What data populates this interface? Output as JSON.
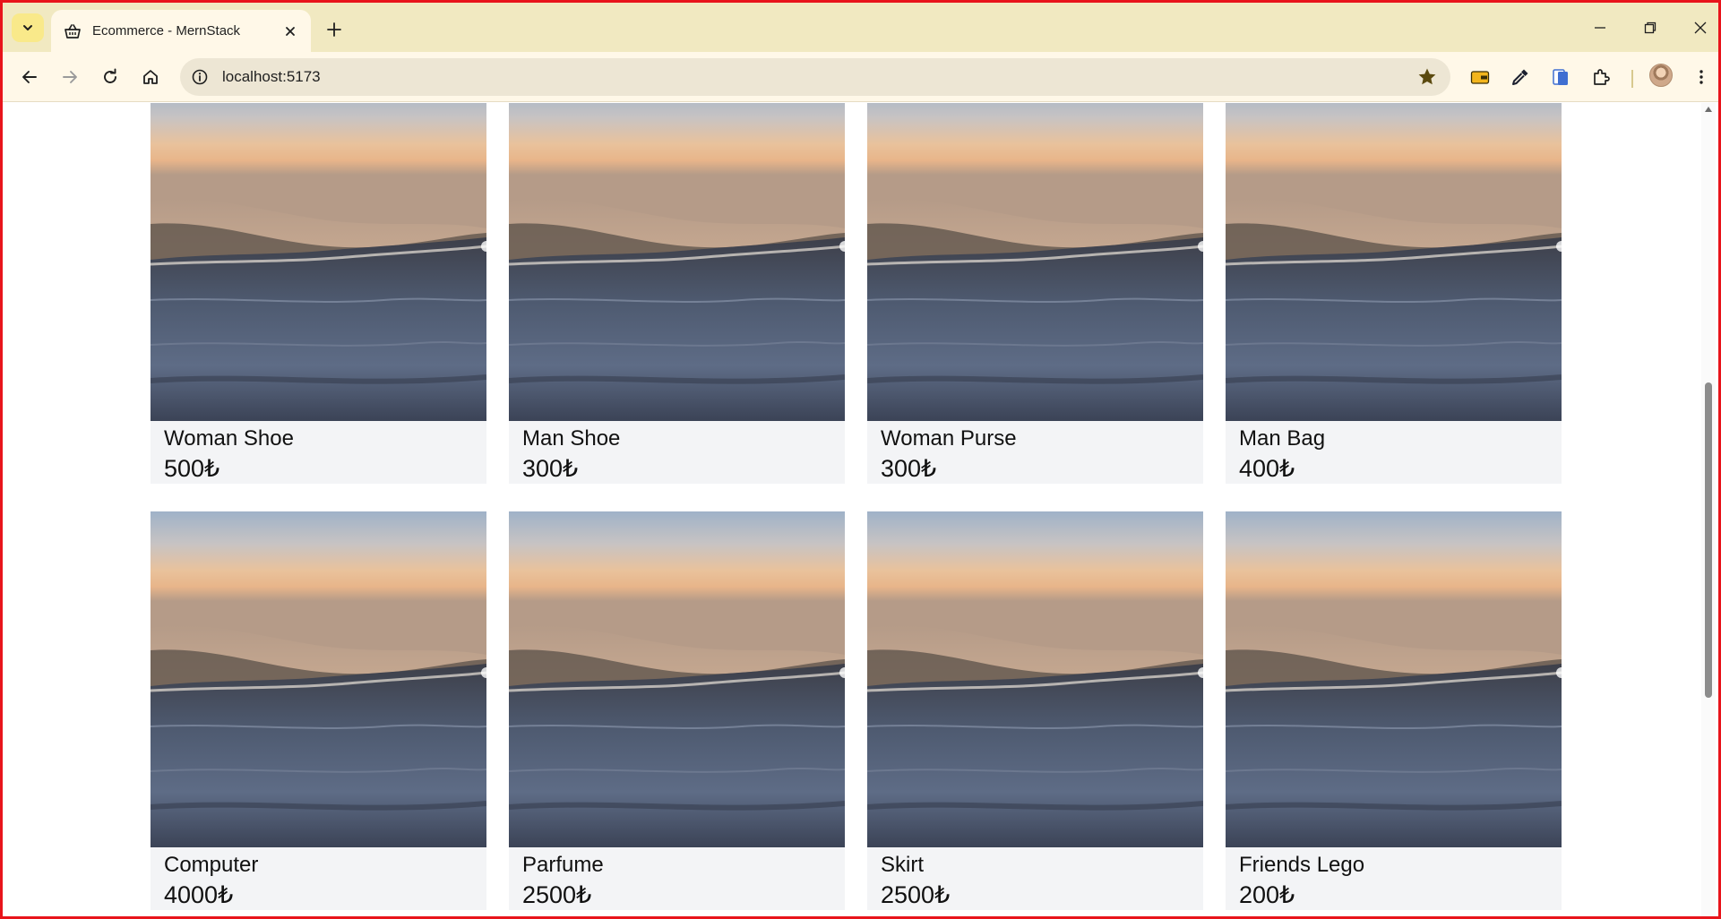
{
  "browser": {
    "tab_title": "Ecommerce - MernStack",
    "url": "localhost:5173",
    "accent_color": "#f1e9c1",
    "frame_color": "#e8141b"
  },
  "icons": {
    "tab_favicon": "basket-icon",
    "bookmark": "star-icon"
  },
  "products": [
    {
      "name": "Woman Shoe",
      "price": "500₺"
    },
    {
      "name": "Man Shoe",
      "price": "300₺"
    },
    {
      "name": "Woman Purse",
      "price": "300₺"
    },
    {
      "name": "Man Bag",
      "price": "400₺"
    },
    {
      "name": "Computer",
      "price": "4000₺"
    },
    {
      "name": "Parfume",
      "price": "2500₺"
    },
    {
      "name": "Skirt",
      "price": "2500₺"
    },
    {
      "name": "Friends Lego",
      "price": "200₺"
    }
  ]
}
